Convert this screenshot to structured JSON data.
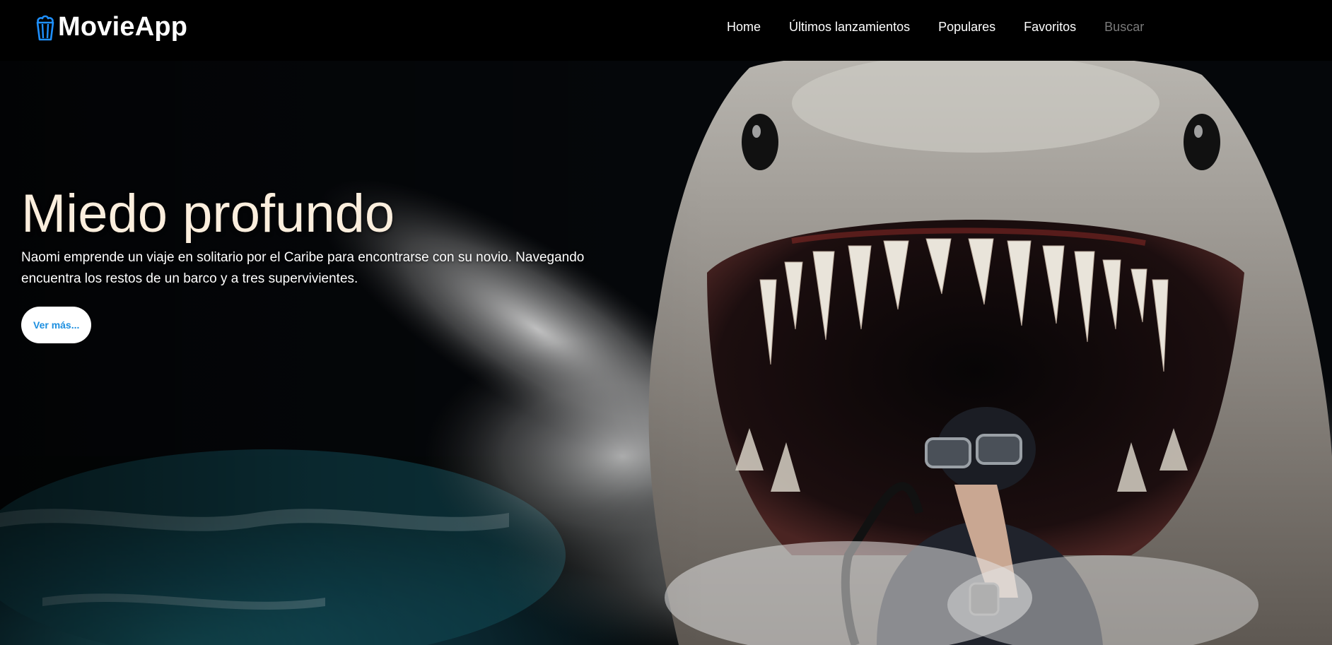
{
  "header": {
    "brand": {
      "icon": "popcorn-icon",
      "name": "MovieApp"
    },
    "nav": [
      {
        "label": "Home"
      },
      {
        "label": "Últimos lanzamientos"
      },
      {
        "label": "Populares"
      },
      {
        "label": "Favoritos"
      },
      {
        "label": "Buscar"
      }
    ]
  },
  "hero": {
    "title": "Miedo profundo",
    "description": "Naomi emprende un viaje en solitario por el Caribe para encontrarse con su novio. Navegando encuentra los restos de un barco y a tres supervivientes.",
    "button_label": "Ver más...",
    "background_image": "shark-attacking-diver-poster"
  },
  "colors": {
    "navbar_bg": "#000000",
    "brand_icon": "#1e90ff",
    "title_text": "#fbeedd",
    "button_text": "#1d8fe0",
    "nav_muted": "#7a7a7a"
  }
}
